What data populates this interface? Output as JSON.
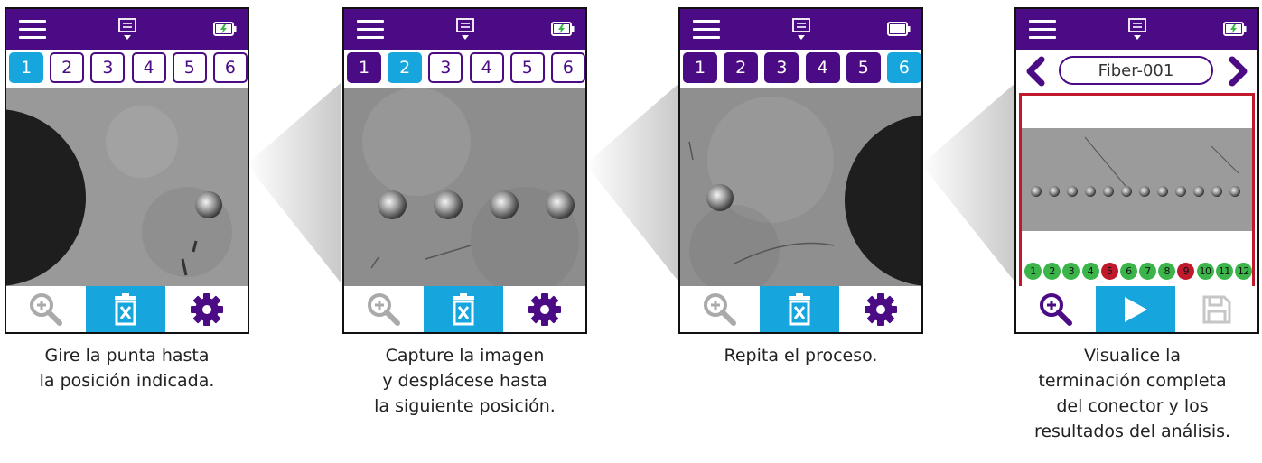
{
  "colors": {
    "brand": "#4b0b84",
    "accent": "#16a5dd",
    "pass": "#3bb54a",
    "fail": "#c0192c"
  },
  "icons": {
    "menu": "hamburger-menu-icon",
    "tray": "tray-download-icon",
    "battery": "battery-icon",
    "zoom": "zoom-in-icon",
    "delete": "delete-icon",
    "settings": "gear-icon",
    "play": "play-icon",
    "save": "save-icon",
    "prev": "chevron-left-icon",
    "next": "chevron-right-icon"
  },
  "screens": [
    {
      "tabs": [
        "1",
        "2",
        "3",
        "4",
        "5",
        "6"
      ],
      "active_tab": "1",
      "battery_charging": true,
      "caption": [
        "Gire la punta hasta",
        "la posición indicada."
      ]
    },
    {
      "tabs": [
        "1",
        "2",
        "3",
        "4",
        "5",
        "6"
      ],
      "active_tab": "2",
      "battery_charging": true,
      "caption": [
        "Capture la imagen",
        "y desplácese hasta",
        "la siguiente posición."
      ]
    },
    {
      "tabs": [
        "1",
        "2",
        "3",
        "4",
        "5",
        "6"
      ],
      "active_tab": "6",
      "battery_charging": false,
      "caption": [
        "Repita el proceso."
      ]
    },
    {
      "fiber_label": "Fiber-001",
      "battery_charging": true,
      "results": [
        {
          "n": "1",
          "status": "pass"
        },
        {
          "n": "2",
          "status": "pass"
        },
        {
          "n": "3",
          "status": "pass"
        },
        {
          "n": "4",
          "status": "pass"
        },
        {
          "n": "5",
          "status": "fail"
        },
        {
          "n": "6",
          "status": "pass"
        },
        {
          "n": "7",
          "status": "pass"
        },
        {
          "n": "8",
          "status": "pass"
        },
        {
          "n": "9",
          "status": "fail"
        },
        {
          "n": "10",
          "status": "pass"
        },
        {
          "n": "11",
          "status": "pass"
        },
        {
          "n": "12",
          "status": "pass"
        }
      ],
      "caption": [
        "Visualice la",
        "terminación completa",
        "del conector y los",
        "resultados del análisis."
      ]
    }
  ]
}
